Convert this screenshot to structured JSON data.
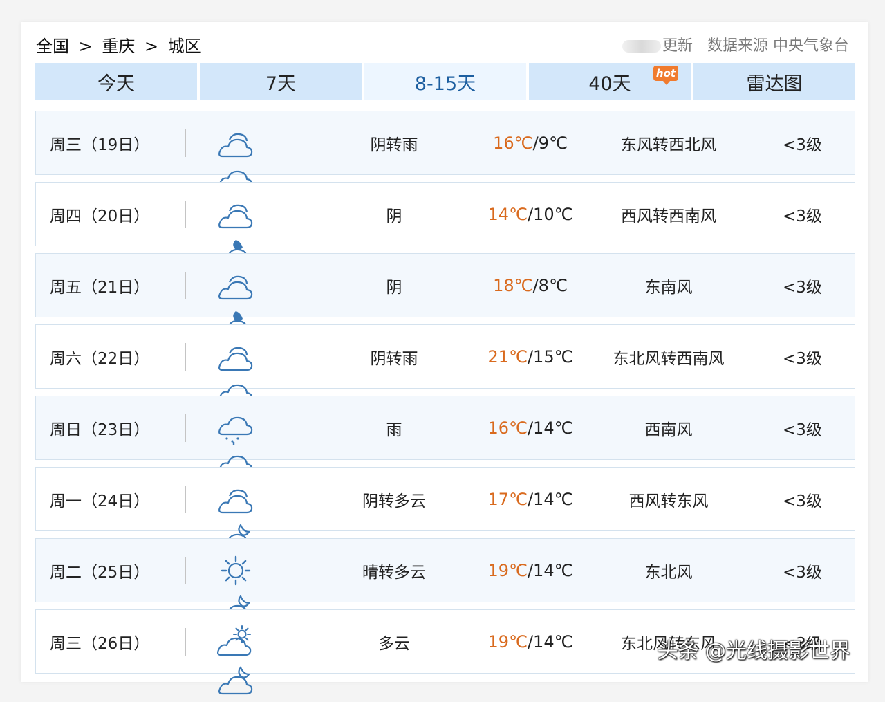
{
  "breadcrumb": {
    "country": "全国",
    "city": "重庆",
    "district": "城区",
    "sep": ">"
  },
  "source": {
    "update_label": "更新",
    "label": "数据来源",
    "provider": "中央气象台"
  },
  "tabs": [
    {
      "label": "今天",
      "active": false
    },
    {
      "label": "7天",
      "active": false
    },
    {
      "label": "8-15天",
      "active": true
    },
    {
      "label": "40天",
      "active": false,
      "badge": "hot"
    },
    {
      "label": "雷达图",
      "active": false
    }
  ],
  "forecast": [
    {
      "date": "周三（19日）",
      "icon_day": "cloudy-icon",
      "icon_night": "rain-icon",
      "desc": "阴转雨",
      "high": "16℃",
      "low": "9℃",
      "wind": "东风转西北风",
      "level": "<3级"
    },
    {
      "date": "周四（20日）",
      "icon_day": "cloudy-icon",
      "icon_night": "cloudy-night-icon",
      "desc": "阴",
      "high": "14℃",
      "low": "10℃",
      "wind": "西风转西南风",
      "level": "<3级"
    },
    {
      "date": "周五（21日）",
      "icon_day": "cloudy-icon",
      "icon_night": "cloudy-night-icon",
      "desc": "阴",
      "high": "18℃",
      "low": "8℃",
      "wind": "东南风",
      "level": "<3级"
    },
    {
      "date": "周六（22日）",
      "icon_day": "cloudy-icon",
      "icon_night": "rain-icon",
      "desc": "阴转雨",
      "high": "21℃",
      "low": "15℃",
      "wind": "东北风转西南风",
      "level": "<3级"
    },
    {
      "date": "周日（23日）",
      "icon_day": "rain-icon",
      "icon_night": "rain-icon",
      "desc": "雨",
      "high": "16℃",
      "low": "14℃",
      "wind": "西南风",
      "level": "<3级"
    },
    {
      "date": "周一（24日）",
      "icon_day": "cloudy-icon",
      "icon_night": "partly-cloudy-night-icon",
      "desc": "阴转多云",
      "high": "17℃",
      "low": "14℃",
      "wind": "西风转东风",
      "level": "<3级"
    },
    {
      "date": "周二（25日）",
      "icon_day": "sunny-icon",
      "icon_night": "partly-cloudy-night-icon",
      "desc": "晴转多云",
      "high": "19℃",
      "low": "14℃",
      "wind": "东北风",
      "level": "<3级"
    },
    {
      "date": "周三（26日）",
      "icon_day": "partly-cloudy-day-icon",
      "icon_night": "partly-cloudy-night-icon",
      "desc": "多云",
      "high": "19℃",
      "low": "14℃",
      "wind": "东北风转东风",
      "level": "<3级"
    }
  ],
  "colors": {
    "tab_bg": "#d3e7fa",
    "tab_active_bg": "#edf6ff",
    "tab_active_text": "#1d5fa0",
    "temp_high": "#d96a1e",
    "icon_stroke": "#3a78b5",
    "row_border": "#d4e2ee",
    "hot_badge": "#f07b2e"
  },
  "watermark": "头条 @光线摄影世界"
}
